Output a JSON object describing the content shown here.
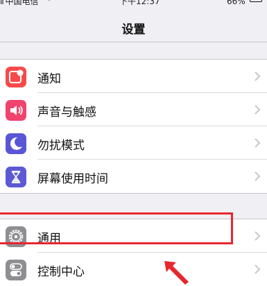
{
  "status_bar": {
    "carrier": "中国电信",
    "time": "下午12:37",
    "battery": "66%"
  },
  "nav": {
    "title": "设置"
  },
  "groups": [
    {
      "rows": [
        {
          "label": "通知",
          "icon": "notifications-icon",
          "color": "#f74a4a"
        },
        {
          "label": "声音与触感",
          "icon": "sounds-icon",
          "color": "#f0436d"
        },
        {
          "label": "勿扰模式",
          "icon": "do-not-disturb-moon-icon",
          "color": "#5856d6"
        },
        {
          "label": "屏幕使用时间",
          "icon": "screen-time-hourglass-icon",
          "color": "#5c59d4"
        }
      ]
    },
    {
      "rows": [
        {
          "label": "通用",
          "icon": "general-gear-icon",
          "color": "#8e8e93"
        },
        {
          "label": "控制中心",
          "icon": "control-center-toggles-icon",
          "color": "#8e8e93"
        }
      ]
    }
  ],
  "annotation": {
    "highlight_color": "#e8262e"
  }
}
